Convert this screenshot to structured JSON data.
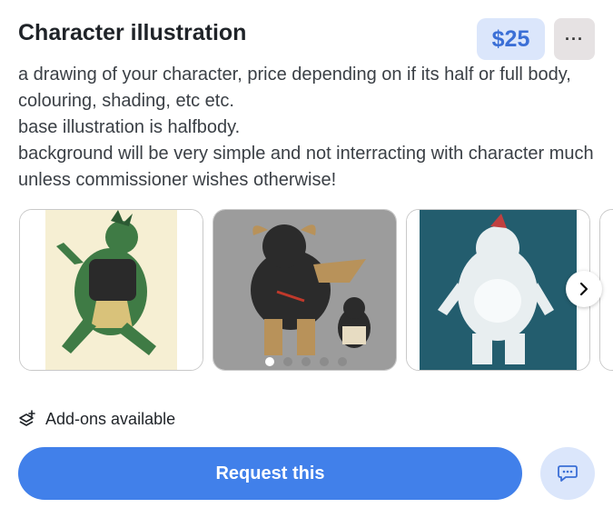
{
  "listing": {
    "title": "Character illustration",
    "price": "$25",
    "more_label": "···",
    "description": [
      "a drawing of your character, price depending on if its half or full body, colouring, shading, etc etc.",
      "base illustration is halfbody.",
      "background will be very simple and not interracting with character much unless commissioner wishes otherwise!"
    ]
  },
  "gallery": {
    "active_index": 0,
    "dot_count": 5,
    "images": [
      {
        "icon": "artwork-green-character-image"
      },
      {
        "icon": "artwork-dark-creatures-image"
      },
      {
        "icon": "artwork-white-furry-creature-image"
      }
    ]
  },
  "addons": {
    "label": "Add-ons available",
    "icon": "layers-plus-icon"
  },
  "actions": {
    "request_label": "Request this",
    "chat_icon": "chat-bubble-icon"
  },
  "colors": {
    "accent": "#4180ea",
    "price_bg": "#dbe6fb",
    "price_text": "#3b6fd6"
  }
}
